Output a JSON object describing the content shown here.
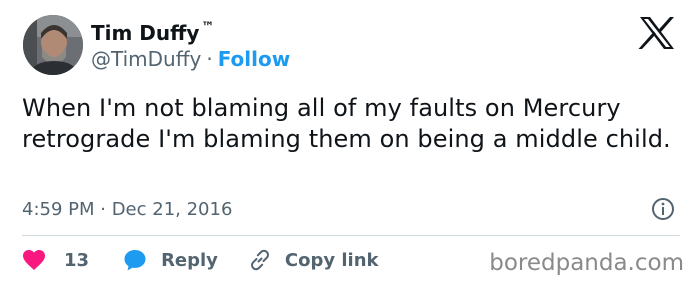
{
  "author": {
    "name": "Tim Duffy",
    "badge": "™",
    "handle": "@TimDuffy",
    "separator": "·",
    "follow_label": "Follow"
  },
  "tweet": {
    "text": "When I'm not blaming all of my faults on Mercury retrograde I'm blaming them on being a middle child.",
    "timestamp": "4:59 PM · Dec 21, 2016"
  },
  "actions": {
    "like_count": "13",
    "reply_label": "Reply",
    "copy_link_label": "Copy link"
  },
  "icons": {
    "logo": "x-logo-icon",
    "info": "info-icon",
    "like": "heart-icon",
    "reply": "speech-bubble-icon",
    "copy": "link-icon"
  },
  "colors": {
    "accent": "#1d9bf0",
    "like": "#f91880",
    "text": "#0f1419",
    "secondary": "#536471",
    "divider": "#cfd9de"
  },
  "watermark": "boredpanda.com"
}
